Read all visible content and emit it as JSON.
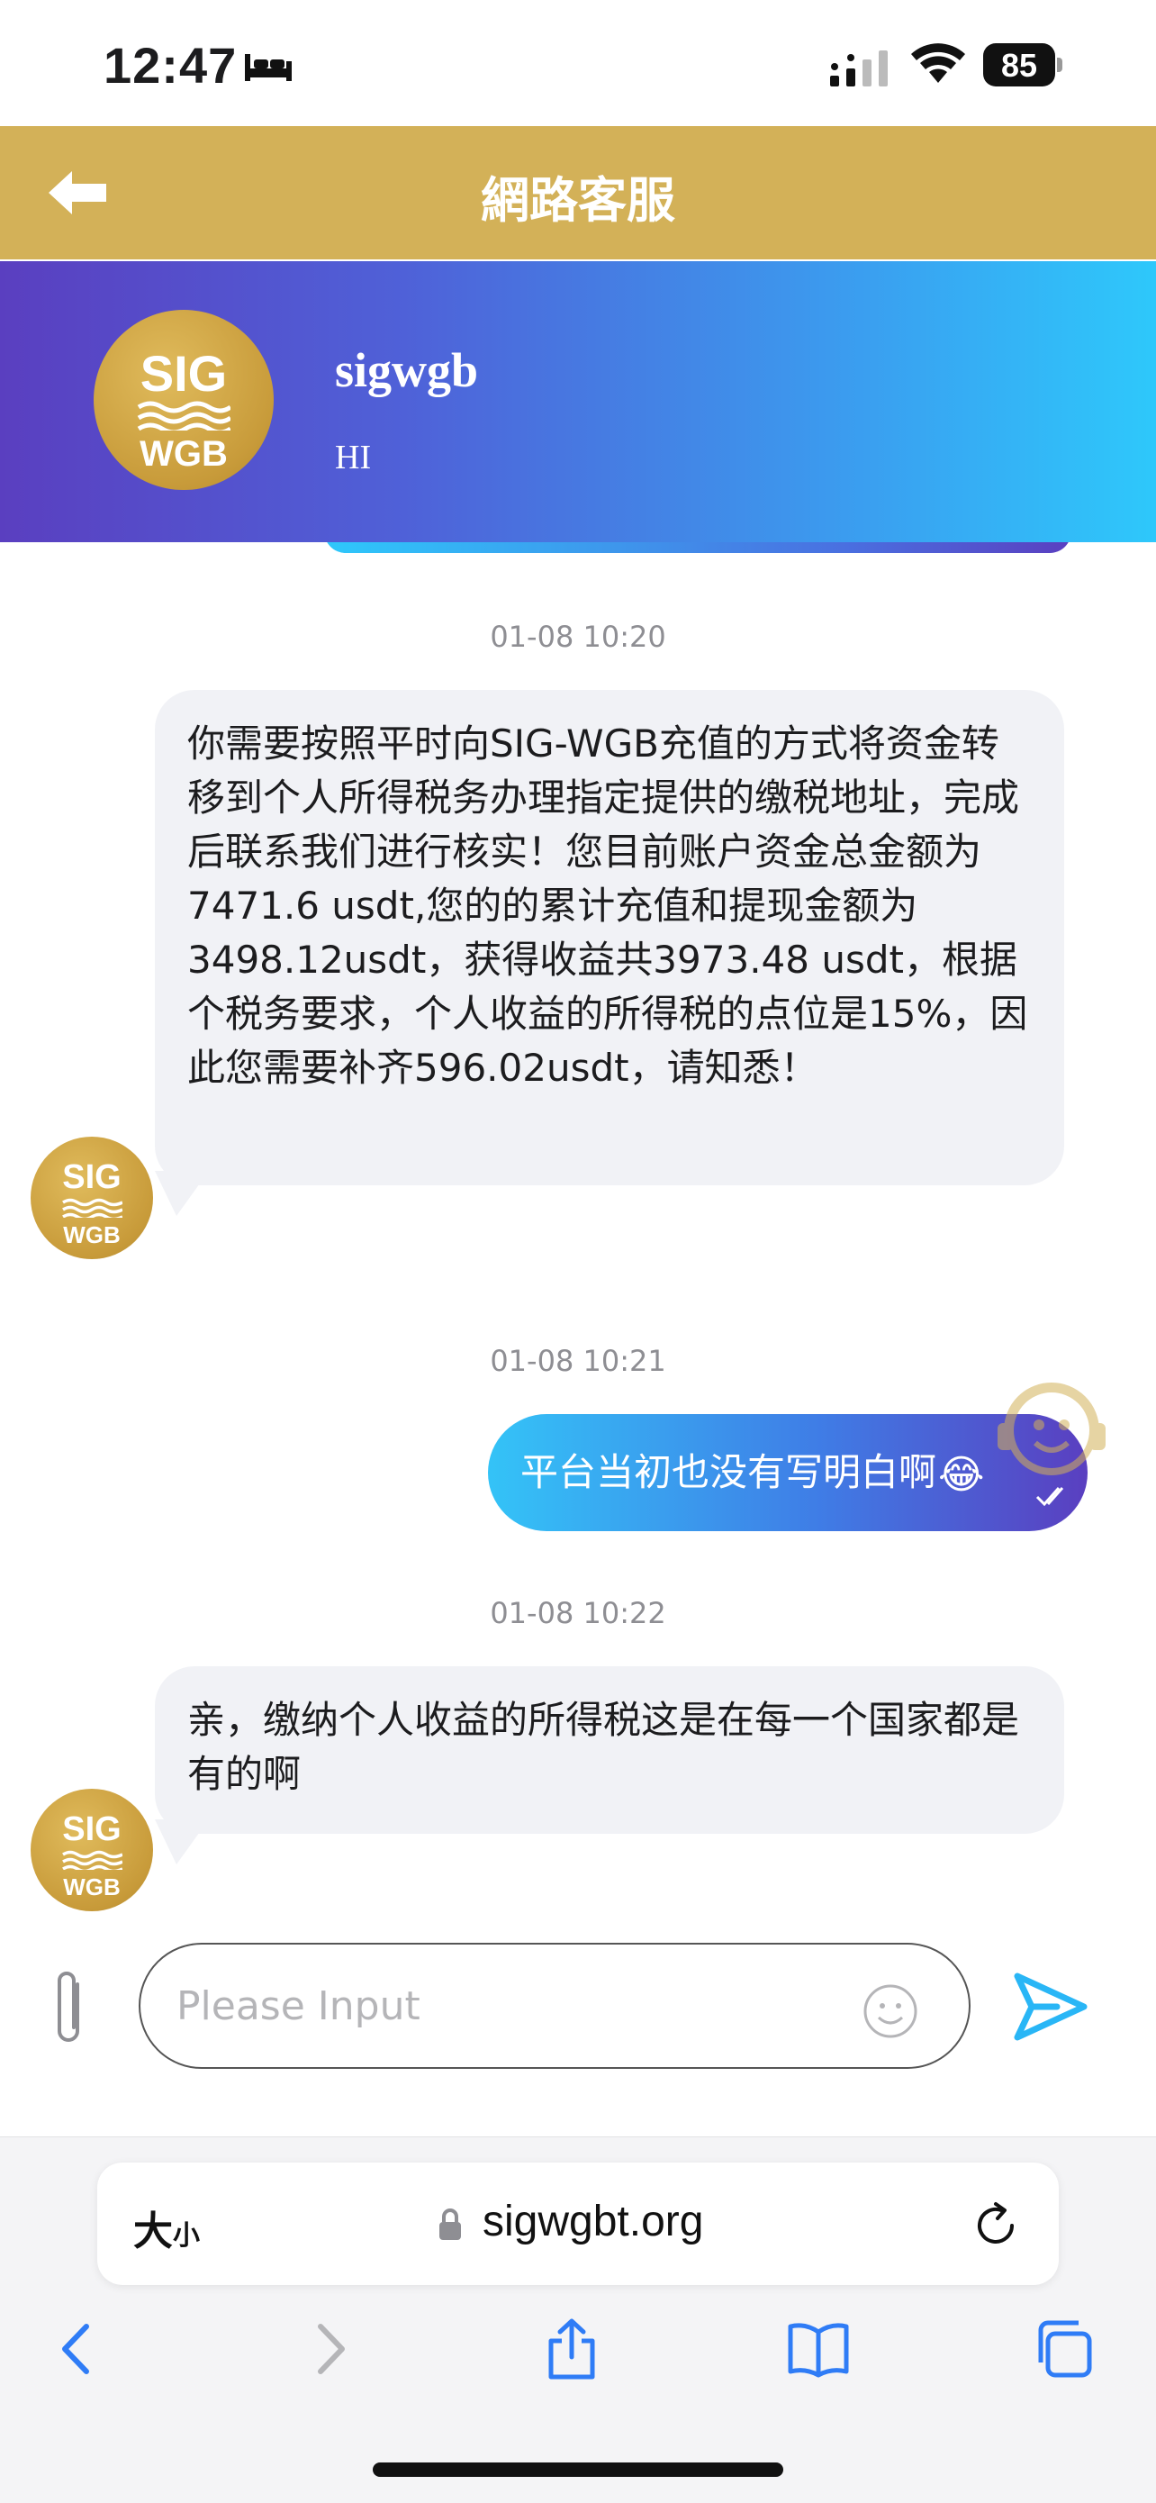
{
  "status_bar": {
    "time": "12:47",
    "battery": "85"
  },
  "header": {
    "title": "網路客服"
  },
  "agent": {
    "name": "sigwgb",
    "status": "HI"
  },
  "logo": {
    "line1": "SIG",
    "line2": "WGB"
  },
  "messages": [
    {
      "timestamp": "01-08 10:20",
      "direction": "incoming",
      "text": "你需要按照平时向SIG-WGB充值的方式将资金转移到个人所得税务办理指定提供的缴税地址，完成后联系我们进行核实！您目前账户资金总金额为7471.6 usdt,您的的累计充值和提现金额为3498.12usdt，获得收益共3973.48 usdt，根据个税务要求，个人收益的所得税的点位是15%，因此您需要补齐596.02usdt，请知悉！"
    },
    {
      "timestamp": "01-08 10:21",
      "direction": "outgoing",
      "text": "平台当初也没有写明白啊",
      "emoji": "😂"
    },
    {
      "timestamp": "01-08 10:22",
      "direction": "incoming",
      "text": "亲，缴纳个人收益的所得税这是在每一个国家都是有的啊"
    }
  ],
  "composer": {
    "placeholder": "Please Input"
  },
  "browser": {
    "text_size_big": "大",
    "text_size_small": "小",
    "url": "sigwgbt.org"
  },
  "colors": {
    "header": "#d3b158",
    "banner_start": "#5a3fc0",
    "banner_end": "#2ec8fb",
    "send": "#29b6f6"
  }
}
